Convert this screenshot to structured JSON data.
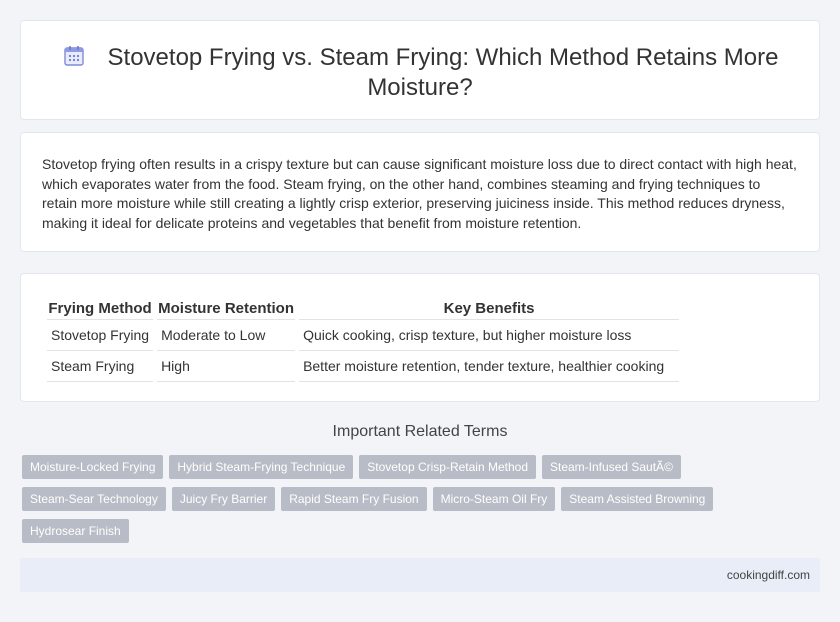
{
  "header": {
    "title": "Stovetop Frying vs. Steam Frying: Which Method Retains More Moisture?",
    "icon": "calendar-icon",
    "accent": "#6b7bd6"
  },
  "intro": {
    "text": "Stovetop frying often results in a crispy texture but can cause significant moisture loss due to direct contact with high heat, which evaporates water from the food. Steam frying, on the other hand, combines steaming and frying techniques to retain more moisture while still creating a lightly crisp exterior, preserving juiciness inside. This method reduces dryness, making it ideal for delicate proteins and vegetables that benefit from moisture retention."
  },
  "comparison": {
    "headers": [
      "Frying Method",
      "Moisture Retention",
      "Key Benefits"
    ],
    "rows": [
      [
        "Stovetop Frying",
        "Moderate to Low",
        "Quick cooking, crisp texture, but higher moisture loss"
      ],
      [
        "Steam Frying",
        "High",
        "Better moisture retention, tender texture, healthier cooking"
      ]
    ]
  },
  "related": {
    "heading": "Important Related Terms",
    "tags": [
      "Moisture-Locked Frying",
      "Hybrid Steam-Frying Technique",
      "Stovetop Crisp-Retain Method",
      "Steam-Infused SautÃ©",
      "Steam-Sear Technology",
      "Juicy Fry Barrier",
      "Rapid Steam Fry Fusion",
      "Micro-Steam Oil Fry",
      "Steam Assisted Browning",
      "Hydrosear Finish"
    ],
    "tag_color": "#b8bcc6"
  },
  "footer": {
    "site": "cookingdiff.com",
    "background": "#e8edf7"
  }
}
